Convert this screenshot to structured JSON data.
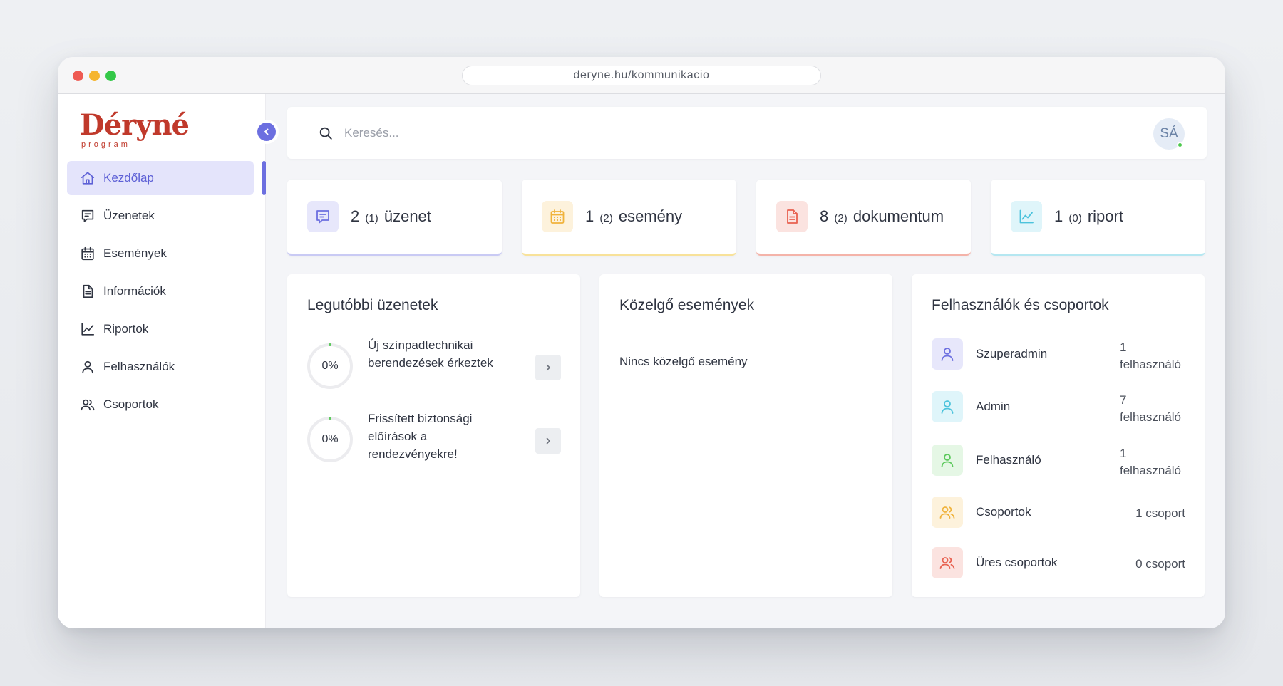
{
  "browser": {
    "url": "deryne.hu/kommunikacio"
  },
  "sidebar": {
    "logo_text": "Déryné",
    "logo_subtext": "program",
    "collapse_icon": "chevron-left-icon",
    "accent_color": "#6c6fe0",
    "items": [
      {
        "label": "Kezdőlap",
        "icon": "home-icon",
        "active": true
      },
      {
        "label": "Üzenetek",
        "icon": "message-icon",
        "active": false
      },
      {
        "label": "Események",
        "icon": "calendar-icon",
        "active": false
      },
      {
        "label": "Információk",
        "icon": "document-icon",
        "active": false
      },
      {
        "label": "Riportok",
        "icon": "chart-icon",
        "active": false
      },
      {
        "label": "Felhasználók",
        "icon": "user-icon",
        "active": false
      },
      {
        "label": "Csoportok",
        "icon": "users-icon",
        "active": false
      }
    ]
  },
  "header": {
    "search_placeholder": "Keresés...",
    "avatar_initials": "SÁ",
    "avatar_status": "online"
  },
  "stats": [
    {
      "count": "2",
      "sub": "(1)",
      "label": "üzenet",
      "icon": "message-icon",
      "color": "#6c6fe0"
    },
    {
      "count": "1",
      "sub": "(2)",
      "label": "esemény",
      "icon": "calendar-icon",
      "color": "#f0b33c"
    },
    {
      "count": "8",
      "sub": "(2)",
      "label": "dokumentum",
      "icon": "document-icon",
      "color": "#e8604f"
    },
    {
      "count": "1",
      "sub": "(0)",
      "label": "riport",
      "icon": "chart-icon",
      "color": "#4cc3dc"
    }
  ],
  "recent_messages": {
    "title": "Legutóbbi üzenetek",
    "items": [
      {
        "progress": "0%",
        "progress_value": 0,
        "text": "Új színpadtechnikai berendezések érkeztek"
      },
      {
        "progress": "0%",
        "progress_value": 0,
        "text": "Frissített biztonsági előírások a rendezvényekre!"
      }
    ]
  },
  "upcoming_events": {
    "title": "Közelgő események",
    "empty_text": "Nincs közelgő esemény"
  },
  "users_groups": {
    "title": "Felhasználók és csoportok",
    "rows": [
      {
        "name": "Szuperadmin",
        "count_num": "1",
        "count_unit": "felhasználó",
        "icon": "user-icon",
        "color": "#6c6fe0",
        "bg": "#e7e7fb"
      },
      {
        "name": "Admin",
        "count_num": "7",
        "count_unit": "felhasználó",
        "icon": "user-icon",
        "color": "#4cc3dc",
        "bg": "#dff5fa"
      },
      {
        "name": "Felhasználó",
        "count_num": "1",
        "count_unit": "felhasználó",
        "icon": "user-icon",
        "color": "#5cc95c",
        "bg": "#e5f7e5"
      },
      {
        "name": "Csoportok",
        "count": "1 csoport",
        "icon": "users-icon",
        "color": "#f0b33c",
        "bg": "#fdf2dc"
      },
      {
        "name": "Üres csoportok",
        "count": "0 csoport",
        "icon": "users-icon",
        "color": "#e8604f",
        "bg": "#fbe3e0"
      }
    ]
  }
}
